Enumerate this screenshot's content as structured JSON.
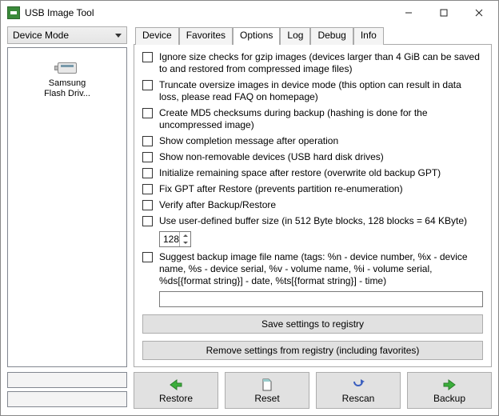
{
  "window": {
    "title": "USB Image Tool"
  },
  "left": {
    "mode_label": "Device Mode",
    "device_label": "Samsung\nFlash Driv..."
  },
  "tabs": {
    "t0": "Device",
    "t1": "Favorites",
    "t2": "Options",
    "t3": "Log",
    "t4": "Debug",
    "t5": "Info"
  },
  "options": {
    "o1": "Ignore size checks for gzip images (devices larger than 4 GiB can be saved to and restored from compressed image files)",
    "o2": "Truncate oversize images in device mode (this option can result in data loss, please read FAQ on homepage)",
    "o3": "Create MD5 checksums during backup (hashing is done for the uncompressed image)",
    "o4": "Show completion message after operation",
    "o5": "Show non-removable devices (USB hard disk drives)",
    "o6": "Initialize remaining space after restore (overwrite old backup GPT)",
    "o7": "Fix GPT after Restore (prevents partition re-enumeration)",
    "o8": "Verify after Backup/Restore",
    "o9": "Use user-defined buffer size (in 512 Byte blocks, 128 blocks = 64 KByte)",
    "buffer_value": "128",
    "o10": "Suggest backup image file name (tags: %n - device number, %x - device name, %s - device serial, %v - volume name, %i - volume serial, %ds[{format string}] - date, %ts[{format string}] - time)",
    "save_btn": "Save settings to registry",
    "remove_btn": "Remove settings from registry (including favorites)"
  },
  "actions": {
    "restore": "Restore",
    "reset": "Reset",
    "rescan": "Rescan",
    "backup": "Backup"
  }
}
